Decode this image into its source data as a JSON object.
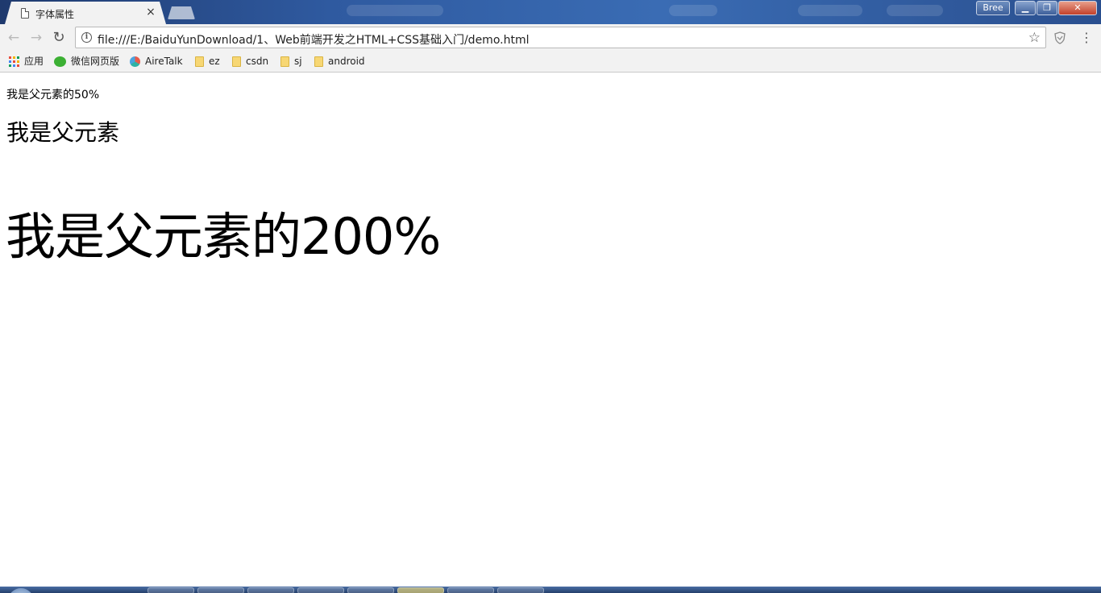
{
  "window": {
    "tab_title": "字体属性",
    "tab_close": "×",
    "user_label": "Bree",
    "minimize": "▁",
    "maximize": "❐",
    "close": "✕"
  },
  "toolbar": {
    "back": "←",
    "forward": "→",
    "reload": "↻",
    "info": "i",
    "url": "file:///E:/BaiduYunDownload/1、Web前端开发之HTML+CSS基础入门/demo.html",
    "star": "☆",
    "menu": "⋮"
  },
  "bookmarks": {
    "items": [
      {
        "label": "应用",
        "icon": "apps-grid-icon"
      },
      {
        "label": "微信网页版",
        "icon": "wechat-icon"
      },
      {
        "label": "AireTalk",
        "icon": "airetalk-icon"
      },
      {
        "label": "ez",
        "icon": "folder-icon"
      },
      {
        "label": "csdn",
        "icon": "folder-icon"
      },
      {
        "label": "sj",
        "icon": "folder-icon"
      },
      {
        "label": "android",
        "icon": "folder-icon"
      }
    ],
    "apps_colors": [
      "#e84c3d",
      "#f4b400",
      "#0f9d58",
      "#4285f4",
      "#e84c3d",
      "#f4b400",
      "#0f9d58",
      "#4285f4",
      "#e84c3d"
    ]
  },
  "page": {
    "line_small": "我是父元素的50%",
    "line_parent": "我是父元素",
    "line_large": "我是父元素的200%"
  }
}
